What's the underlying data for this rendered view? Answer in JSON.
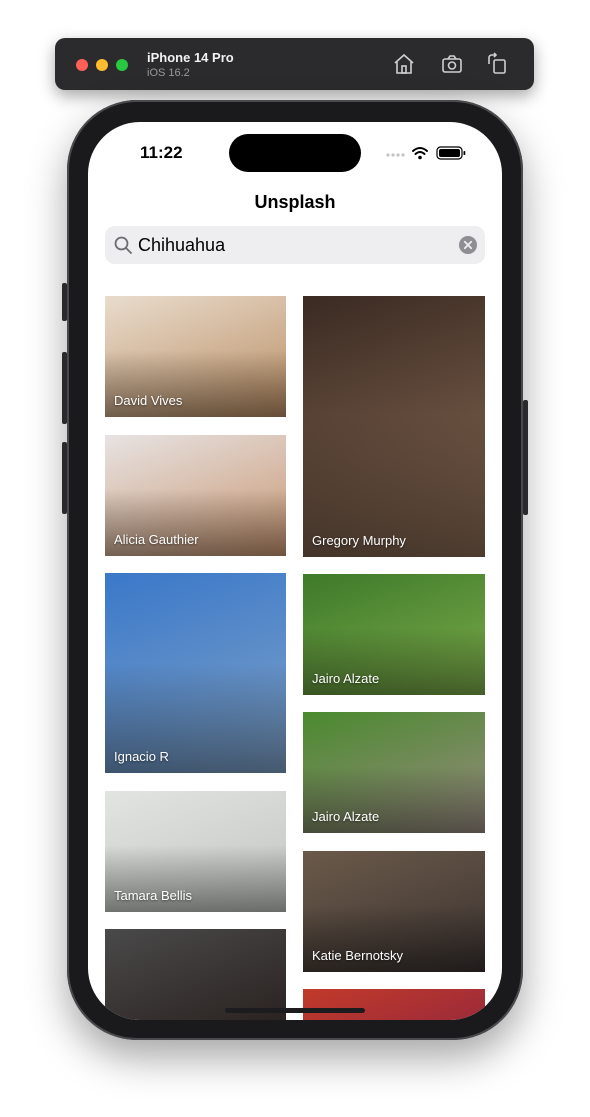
{
  "simulator": {
    "device_name": "iPhone 14 Pro",
    "os_version": "iOS 16.2",
    "buttons": [
      "home-icon",
      "screenshot-icon",
      "rotate-icon"
    ]
  },
  "status_bar": {
    "time": "11:22"
  },
  "nav": {
    "title": "Unsplash"
  },
  "search": {
    "value": "Chihuahua"
  },
  "photos": [
    {
      "author": "David Vives",
      "colors": [
        "#e9dccd",
        "#b98d62"
      ]
    },
    {
      "author": "Gregory Murphy",
      "colors": [
        "#3a2a22",
        "#8a6b55"
      ]
    },
    {
      "author": "Alicia Gauthier",
      "colors": [
        "#e7e3e3",
        "#c89670"
      ]
    },
    {
      "author": "Jairo Alzate",
      "colors": [
        "#3e7a2a",
        "#7cab4a"
      ]
    },
    {
      "author": "Ignacio R",
      "colors": [
        "#3a78c9",
        "#7fa2c8"
      ]
    },
    {
      "author": "Jairo Alzate",
      "colors": [
        "#4a8a2e",
        "#9a8b82"
      ]
    },
    {
      "author": "Tamara Bellis",
      "colors": [
        "#e2e4e2",
        "#c0c4c0"
      ]
    },
    {
      "author": "Katie Bernotsky",
      "colors": [
        "#6b5a4a",
        "#3a3230"
      ]
    },
    {
      "author": "",
      "colors": [
        "#4a4a4a",
        "#2a2220"
      ]
    },
    {
      "author": "",
      "colors": [
        "#c23a2a",
        "#9a2a3a"
      ]
    }
  ]
}
